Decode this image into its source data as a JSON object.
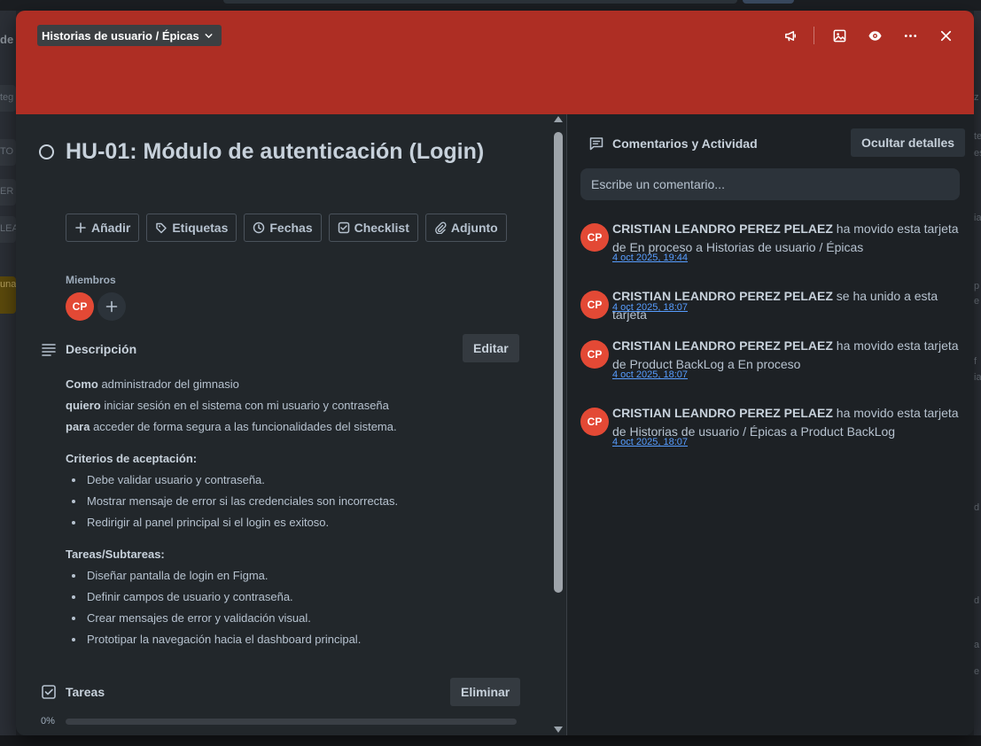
{
  "backdrop": {
    "left_fragments": [
      "de",
      "teg",
      "TO",
      "ER",
      "LEA",
      "una"
    ],
    "right_fragments": [
      "z",
      "te",
      "es",
      "ia",
      "p",
      "e",
      "f",
      "ia",
      "d",
      "d",
      "a",
      "e"
    ]
  },
  "header": {
    "list_name": "Historias de usuario / Épicas",
    "cover_color": "#ae2e24",
    "icons": [
      "megaphone-icon",
      "image-icon",
      "eye-icon",
      "more-icon",
      "close-icon"
    ]
  },
  "card": {
    "title": "HU-01: Módulo de autenticación (Login)",
    "actions": [
      "Añadir",
      "Etiquetas",
      "Fechas",
      "Checklist",
      "Adjunto"
    ],
    "members_label": "Miembros",
    "members": [
      "CP"
    ]
  },
  "description": {
    "label": "Descripción",
    "edit_label": "Editar",
    "como_b": "Como",
    "como": " administrador del gimnasio",
    "quiero_b": "quiero",
    "quiero": " iniciar sesión en el sistema con mi usuario y contraseña",
    "para_b": "para",
    "para": " acceder de forma segura a las funcionalidades del sistema.",
    "criteria_title": "Criterios de aceptación:",
    "criteria": [
      "Debe validar usuario y contraseña.",
      "Mostrar mensaje de error si las credenciales son incorrectas.",
      "Redirigir al panel principal si el login es exitoso."
    ],
    "tasks_title": "Tareas/Subtareas:",
    "tasks": [
      "Diseñar pantalla de login en Figma.",
      "Definir campos de usuario y contraseña.",
      "Crear mensajes de error y validación visual.",
      "Prototipar la navegación hacia el dashboard principal."
    ]
  },
  "checklist": {
    "label": "Tareas",
    "delete_label": "Eliminar",
    "percent": "0%",
    "progress": 0
  },
  "activity": {
    "title": "Comentarios y Actividad",
    "hide_label": "Ocultar detalles",
    "comment_placeholder": "Escribe un comentario...",
    "items": [
      {
        "initials": "CP",
        "user": "CRISTIAN LEANDRO PEREZ PELAEZ",
        "text": " ha movido esta tarjeta de En proceso a Historias de usuario / Épicas",
        "time": "4 oct 2025, 19:44"
      },
      {
        "initials": "CP",
        "user": "CRISTIAN LEANDRO PEREZ PELAEZ",
        "text": " se ha unido a esta tarjeta",
        "time": "4 oct 2025, 18:07"
      },
      {
        "initials": "CP",
        "user": "CRISTIAN LEANDRO PEREZ PELAEZ",
        "text": " ha movido esta tarjeta de Product BackLog a En proceso",
        "time": "4 oct 2025, 18:07"
      },
      {
        "initials": "CP",
        "user": "CRISTIAN LEANDRO PEREZ PELAEZ",
        "text": " ha movido esta tarjeta de Historias de usuario / Épicas a Product BackLog",
        "time": "4 oct 2025, 18:07"
      }
    ]
  }
}
